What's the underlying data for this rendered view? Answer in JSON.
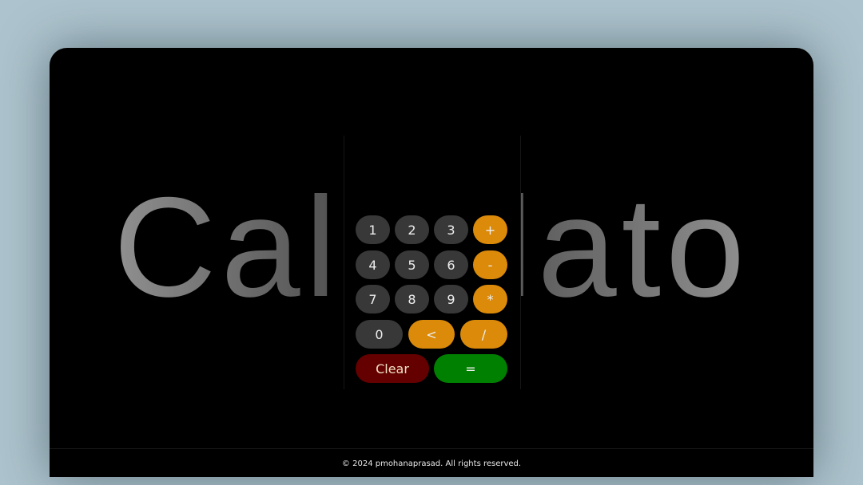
{
  "title": "Calculator",
  "keypad": {
    "rows": [
      [
        "1",
        "2",
        "3",
        "+"
      ],
      [
        "4",
        "5",
        "6",
        "-"
      ],
      [
        "7",
        "8",
        "9",
        "*"
      ],
      [
        "0",
        "<",
        "/"
      ],
      [
        "Clear",
        "="
      ]
    ]
  },
  "colors": {
    "number": "#383838",
    "operator": "#db8a0a",
    "clear": "#640000",
    "equals": "#008000"
  },
  "footer": {
    "text": "© 2024 pmohanaprasad. All rights reserved."
  }
}
